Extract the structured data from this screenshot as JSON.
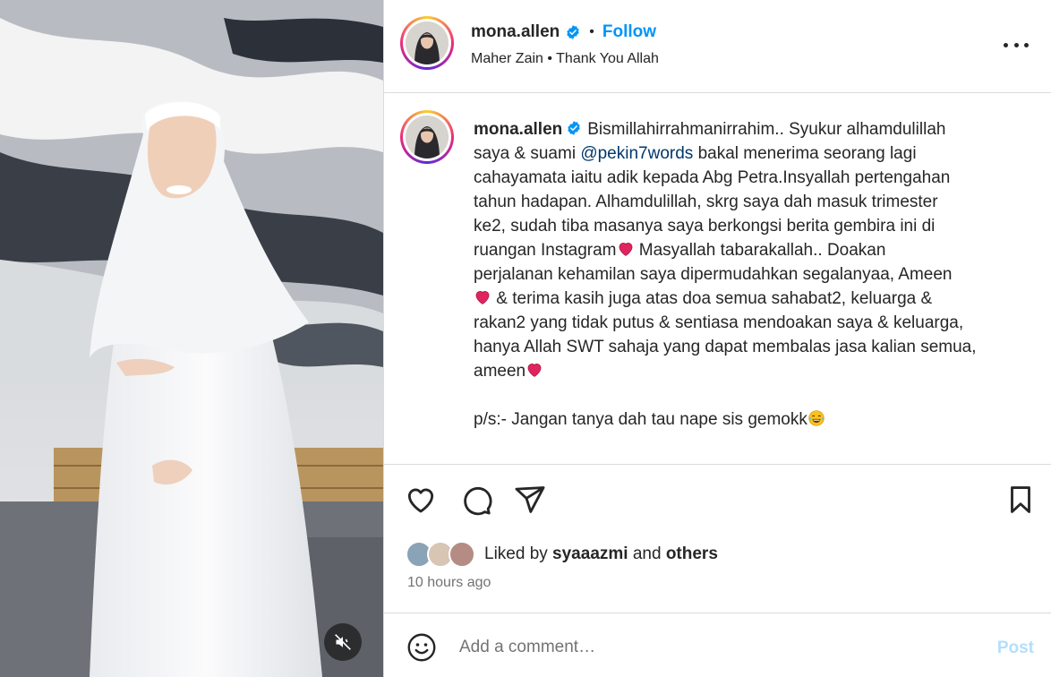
{
  "media": {
    "mute_icon": "speaker-muted-icon"
  },
  "header": {
    "username": "mona.allen",
    "verified_icon": "verified-badge-icon",
    "separator": "•",
    "follow_label": "Follow",
    "audio_artist": "Maher Zain",
    "audio_separator": "•",
    "audio_track": "Thank You Allah",
    "more_icon": "more-options-icon"
  },
  "caption": {
    "username": "mona.allen",
    "lines": {
      "l1": "Bismillahirrahmanirrahim.. Syukur alhamdulillah",
      "l2a": "saya & suami ",
      "l2_mention": "@pekin7words",
      "l2b": " bakal menerima seorang lagi",
      "l3": "cahayamata iaitu adik kepada Abg Petra.Insyallah pertengahan",
      "l4": "tahun hadapan. Alhamdulillah, skrg saya dah masuk trimester",
      "l5": "ke2, sudah tiba masanya saya berkongsi berita gembira ini di",
      "l6a": "ruangan Instagram",
      "l6b": " Masyallah tabarakallah.. Doakan",
      "l7": "perjalanan kehamilan saya dipermudahkan segalanyaa, Ameen",
      "l8b": " & terima kasih juga atas doa semua sahabat2, keluarga &",
      "l9": "rakan2 yang tidak putus & sentiasa mendoakan saya & keluarga,",
      "l10": "hanya Allah SWT sahaja yang dapat membalas jasa kalian semua,",
      "l11": "ameen",
      "l12": "p/s:- Jangan tanya dah tau nape sis gemokk"
    },
    "emoji": {
      "heart": "red-heart-emoji",
      "laugh": "tears-of-joy-emoji"
    }
  },
  "actions": {
    "like_icon": "heart-icon",
    "comment_icon": "comment-bubble-icon",
    "share_icon": "paper-plane-icon",
    "save_icon": "bookmark-icon"
  },
  "likes": {
    "prefix": "Liked by ",
    "user": "syaaazmi",
    "middle": " and ",
    "others": "others"
  },
  "timestamp": "10 hours ago",
  "comment": {
    "placeholder": "Add a comment…",
    "post_label": "Post",
    "emoji_icon": "smiley-face-icon"
  },
  "colors": {
    "link_blue": "#0095f6",
    "mention": "#00376b",
    "post_disabled": "#b2dffc",
    "muted_text": "#737373",
    "divider": "#dbdbdb"
  }
}
